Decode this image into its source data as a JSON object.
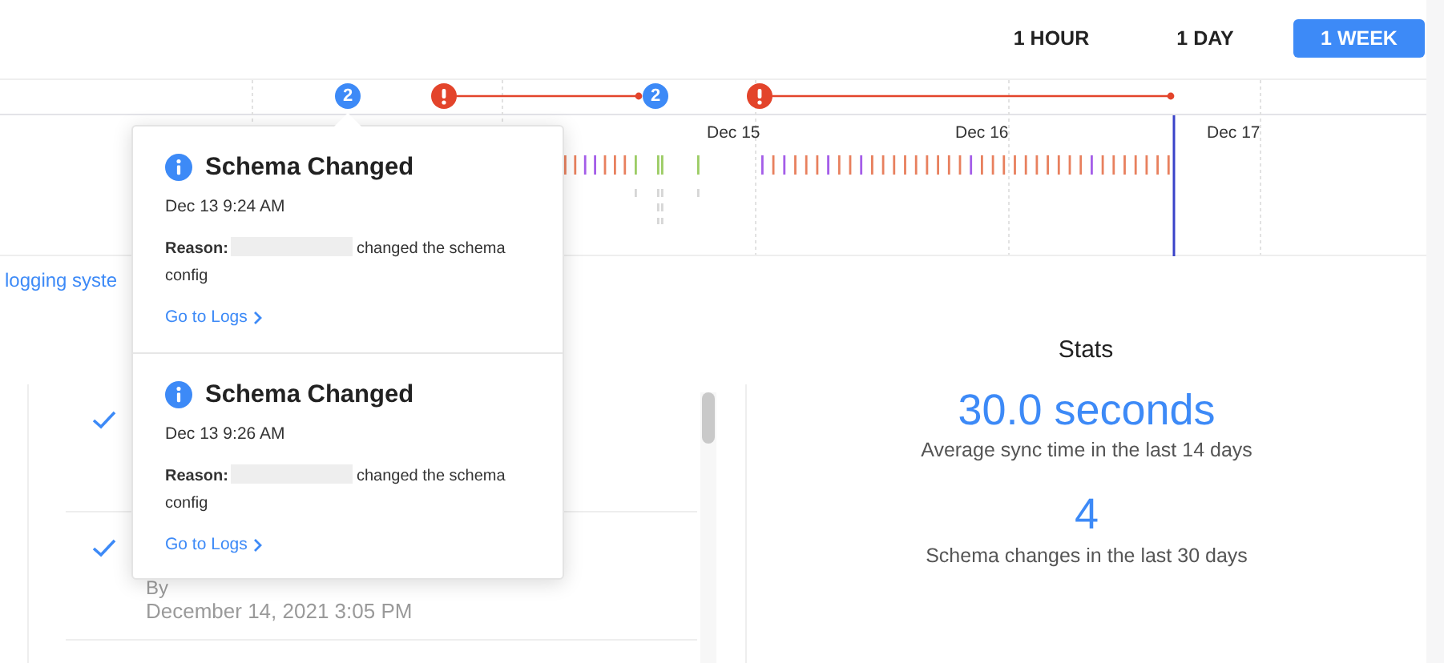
{
  "range_tabs": [
    {
      "label": "1 HOUR",
      "selected": false
    },
    {
      "label": "1 DAY",
      "selected": false
    },
    {
      "label": "1 WEEK",
      "selected": true
    }
  ],
  "timeline": {
    "events": [
      {
        "kind": "count",
        "label": "2"
      },
      {
        "kind": "error"
      },
      {
        "kind": "count",
        "label": "2"
      },
      {
        "kind": "error"
      }
    ],
    "date_labels": [
      "Dec 15",
      "Dec 16",
      "Dec 17"
    ]
  },
  "logs_link": "logging syste",
  "popover": {
    "items": [
      {
        "title": "Schema Changed",
        "time": "Dec 13 9:24 AM",
        "reason_label": "Reason:",
        "reason_text": "changed the schema config",
        "link": "Go to Logs"
      },
      {
        "title": "Schema Changed",
        "time": "Dec 13 9:26 AM",
        "reason_label": "Reason:",
        "reason_text": "changed the schema config",
        "link": "Go to Logs"
      }
    ]
  },
  "history": {
    "rows": [
      {
        "checked": true
      },
      {
        "checked": true,
        "by": "By",
        "date": "December 14, 2021 3:05 PM"
      }
    ]
  },
  "stats": {
    "title": "Stats",
    "items": [
      {
        "value": "30.0 seconds",
        "caption": "Average sync time in the last 14 days"
      },
      {
        "value": "4",
        "caption": "Schema changes in the last 30 days"
      }
    ]
  }
}
